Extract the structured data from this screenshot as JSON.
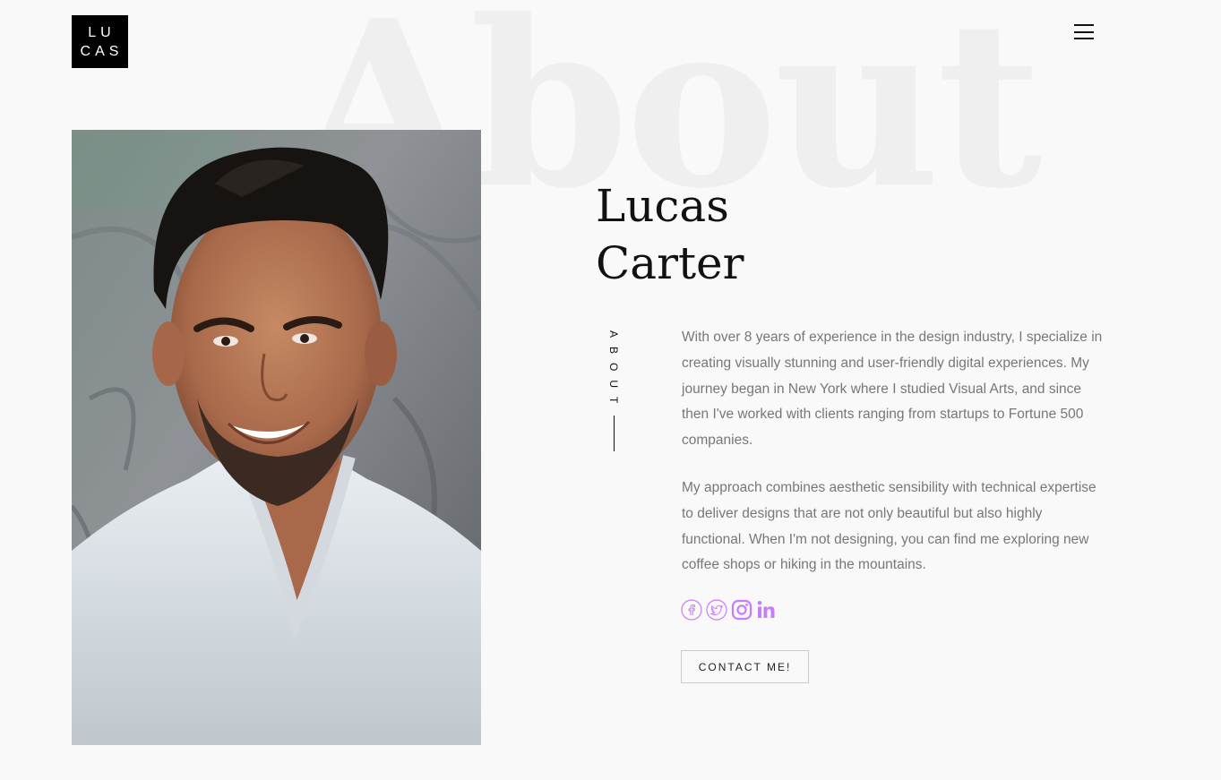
{
  "header": {
    "logo_line1": "LU",
    "logo_line2": "CAS",
    "menu_icon": "hamburger-menu-icon"
  },
  "background_word": "About",
  "profile": {
    "first_name": "Lucas",
    "last_name": "Carter",
    "section_label": "ABOUT",
    "photo_description": "portrait-photo"
  },
  "bio": {
    "paragraph1": "With over 8 years of experience in the design industry, I specialize in creating visually stunning and user-friendly digital experiences. My journey began in New York where I studied Visual Arts, and since then I've worked with clients ranging from startups to Fortune 500 companies.",
    "paragraph2": "My approach combines aesthetic sensibility with technical expertise to deliver designs that are not only beautiful but also highly functional. When I'm not designing, you can find me exploring new coffee shops or hiking in the mountains."
  },
  "social": {
    "icons": [
      "facebook-icon",
      "twitter-icon",
      "instagram-icon",
      "linkedin-icon"
    ],
    "color": "#c77dff"
  },
  "cta": {
    "contact_label": "CONTACT ME!"
  },
  "colors": {
    "background": "#f9f9f9",
    "text": "#111111",
    "body_text": "#777777",
    "accent": "#c77dff",
    "bg_word": "#efefef"
  }
}
